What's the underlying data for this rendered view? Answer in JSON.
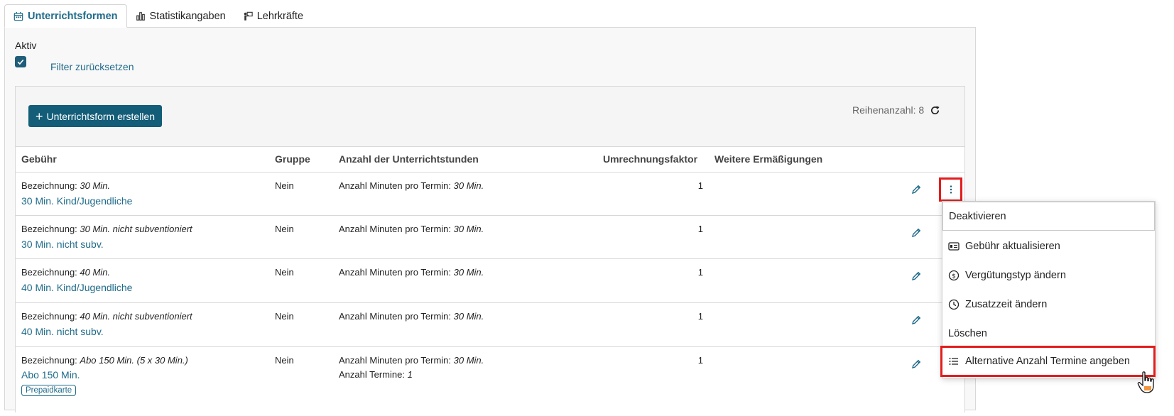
{
  "tabs": [
    {
      "label": "Unterrichtsformen",
      "icon": "calendar-icon",
      "active": true
    },
    {
      "label": "Statistikangaben",
      "icon": "bar-chart-icon",
      "active": false
    },
    {
      "label": "Lehrkräfte",
      "icon": "teacher-icon",
      "active": false
    }
  ],
  "filter": {
    "aktiv_label": "Aktiv",
    "aktiv_checked": true,
    "reset_label": "Filter zurücksetzen"
  },
  "toolbar": {
    "create_label": "Unterrichtsform erstellen",
    "row_count": "Reihenanzahl: 8"
  },
  "table": {
    "headers": [
      "Gebühr",
      "Gruppe",
      "Anzahl der Unterrichtstunden",
      "Umrechnungsfaktor",
      "Weitere Ermäßigungen"
    ],
    "rows": [
      {
        "bez_label": "Bezeichnung:",
        "bez_value": "30 Min.",
        "name": "30 Min. Kind/Jugendliche",
        "gruppe": "Nein",
        "stunden_label": "Anzahl Minuten pro Termin:",
        "stunden_value": "30 Min.",
        "faktor": "1"
      },
      {
        "bez_label": "Bezeichnung:",
        "bez_value": "30 Min. nicht subventioniert",
        "name": "30 Min. nicht subv.",
        "gruppe": "Nein",
        "stunden_label": "Anzahl Minuten pro Termin:",
        "stunden_value": "30 Min.",
        "faktor": "1"
      },
      {
        "bez_label": "Bezeichnung:",
        "bez_value": "40 Min.",
        "name": "40 Min. Kind/Jugendliche",
        "gruppe": "Nein",
        "stunden_label": "Anzahl Minuten pro Termin:",
        "stunden_value": "30 Min.",
        "faktor": "1"
      },
      {
        "bez_label": "Bezeichnung:",
        "bez_value": "40 Min. nicht subventioniert",
        "name": "40 Min. nicht subv.",
        "gruppe": "Nein",
        "stunden_label": "Anzahl Minuten pro Termin:",
        "stunden_value": "30 Min.",
        "faktor": "1"
      },
      {
        "bez_label": "Bezeichnung:",
        "bez_value": "Abo 150 Min. (5 x 30 Min.)",
        "name": "Abo 150 Min.",
        "gruppe": "Nein",
        "stunden_label": "Anzahl Minuten pro Termin:",
        "stunden_value": "30 Min.",
        "termine_label": "Anzahl Termine:",
        "termine_value": "1",
        "faktor": "1",
        "badge": "Prepaidkarte"
      }
    ]
  },
  "menu": {
    "items": [
      {
        "label": "Deaktivieren",
        "icon": ""
      },
      {
        "label": "Gebühr aktualisieren",
        "icon": "id-card-icon"
      },
      {
        "label": "Vergütungstyp ändern",
        "icon": "dollar-circle-icon"
      },
      {
        "label": "Zusatzzeit ändern",
        "icon": "clock-icon"
      },
      {
        "label": "Löschen",
        "icon": ""
      },
      {
        "label": "Alternative Anzahl Termine angeben",
        "icon": "list-icon"
      }
    ]
  },
  "colors": {
    "accent": "#1f6b8a",
    "button": "#135d78",
    "highlight": "#e31d1d"
  }
}
